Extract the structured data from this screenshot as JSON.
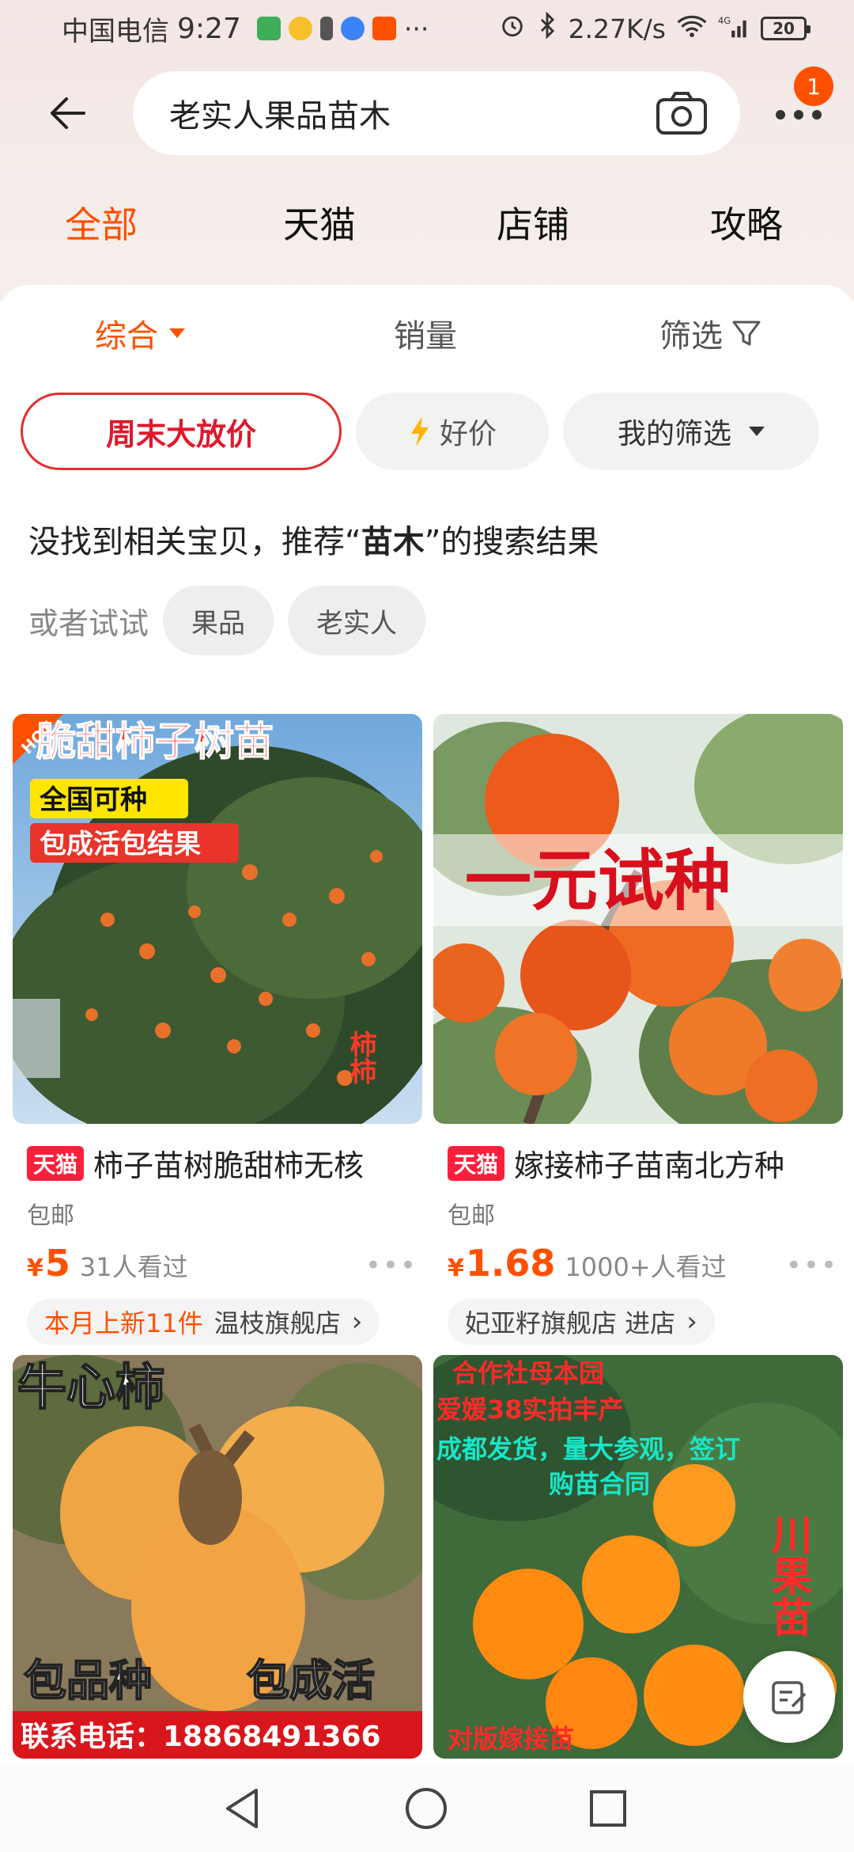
{
  "status_bar": {
    "carrier": "中国电信",
    "time": "9:27",
    "more": "···",
    "network_speed": "2.27K/s",
    "network_type": "4G",
    "battery": "20"
  },
  "search": {
    "query": "老实人果品苗木",
    "notification_count": "1"
  },
  "tabs": [
    {
      "label": "全部",
      "active": true
    },
    {
      "label": "天猫",
      "active": false
    },
    {
      "label": "店铺",
      "active": false
    },
    {
      "label": "攻略",
      "active": false
    }
  ],
  "sort": {
    "comprehensive": "综合",
    "sales": "销量",
    "filter": "筛选"
  },
  "chips": {
    "promo": "周末大放价",
    "good_price": "好价",
    "my_filter": "我的筛选"
  },
  "notice": {
    "prefix": "没找到相关宝贝，推荐“",
    "keyword": "苗木",
    "suffix": "”的搜索结果",
    "try_label": "或者试试",
    "suggestions": [
      "果品",
      "老实人"
    ]
  },
  "products": [
    {
      "tag": "天猫",
      "title": "柿子苗树脆甜柿无核",
      "shipping": "包邮",
      "currency": "¥",
      "price": "5",
      "views": "31人看过",
      "shop_highlight": "本月上新11件",
      "shop_name": "温枝旗舰店",
      "img_texts": {
        "hot": "HOT",
        "headline": "脆甜柿子树苗",
        "line1": "全国可种",
        "line2": "包成活包结果",
        "side": "柿柿"
      }
    },
    {
      "tag": "天猫",
      "title": "嫁接柿子苗南北方种",
      "shipping": "包邮",
      "currency": "¥",
      "price": "1.68",
      "views": "1000+人看过",
      "shop_highlight": "",
      "shop_name": "妃亚籽旗舰店 进店",
      "img_texts": {
        "headline": "一元试种"
      }
    },
    {
      "img_texts": {
        "headline": "牛心柿",
        "left": "包品种",
        "right": "包成活",
        "phone": "联系电话：18868491366"
      }
    },
    {
      "img_texts": {
        "line1": "合作社母本园",
        "line2": "爱媛38实拍丰产",
        "line3": "成都发货，量大参观，签订",
        "line4": "购苗合同",
        "side": "川果苗",
        "bottom": "对版嫁接苗"
      }
    }
  ],
  "colors": {
    "accent": "#ff5000",
    "tmall_red": "#ff1e3c",
    "promo_red": "#e0182c"
  }
}
